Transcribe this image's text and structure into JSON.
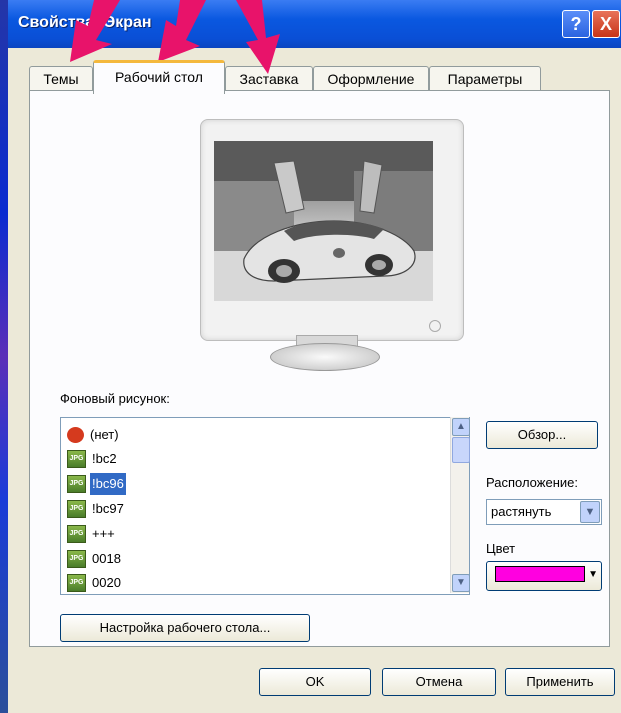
{
  "window": {
    "title": "Свойства: Экран"
  },
  "title_buttons": {
    "help": "?",
    "close": "X"
  },
  "tabs": [
    {
      "label": "Темы"
    },
    {
      "label": "Рабочий стол"
    },
    {
      "label": "Заставка"
    },
    {
      "label": "Оформление"
    },
    {
      "label": "Параметры"
    }
  ],
  "background": {
    "label": "Фоновый рисунок:",
    "items": [
      {
        "name": "(нет)",
        "icon": "none-icon",
        "selected": false
      },
      {
        "name": "!bc2",
        "icon": "jpg-icon",
        "selected": false
      },
      {
        "name": "!bc96",
        "icon": "jpg-icon",
        "selected": true
      },
      {
        "name": "!bc97",
        "icon": "jpg-icon",
        "selected": false
      },
      {
        "name": "+++",
        "icon": "jpg-icon",
        "selected": false
      },
      {
        "name": "0018",
        "icon": "jpg-icon",
        "selected": false
      },
      {
        "name": "0020",
        "icon": "jpg-icon",
        "selected": false
      }
    ],
    "icon_text": "JPG"
  },
  "browse_button": "Обзор...",
  "position": {
    "label": "Расположение:",
    "value": "растянуть"
  },
  "color": {
    "label": "Цвет",
    "value": "#ff00e0"
  },
  "customize_button": "Настройка рабочего стола...",
  "footer": {
    "ok": "OK",
    "cancel": "Отмена",
    "apply": "Применить"
  },
  "colors": {
    "titlebar": "#0a58e0",
    "selection": "#316ac5",
    "arrows": "#e8136a",
    "active_tab_accent": "#f4b83c"
  }
}
